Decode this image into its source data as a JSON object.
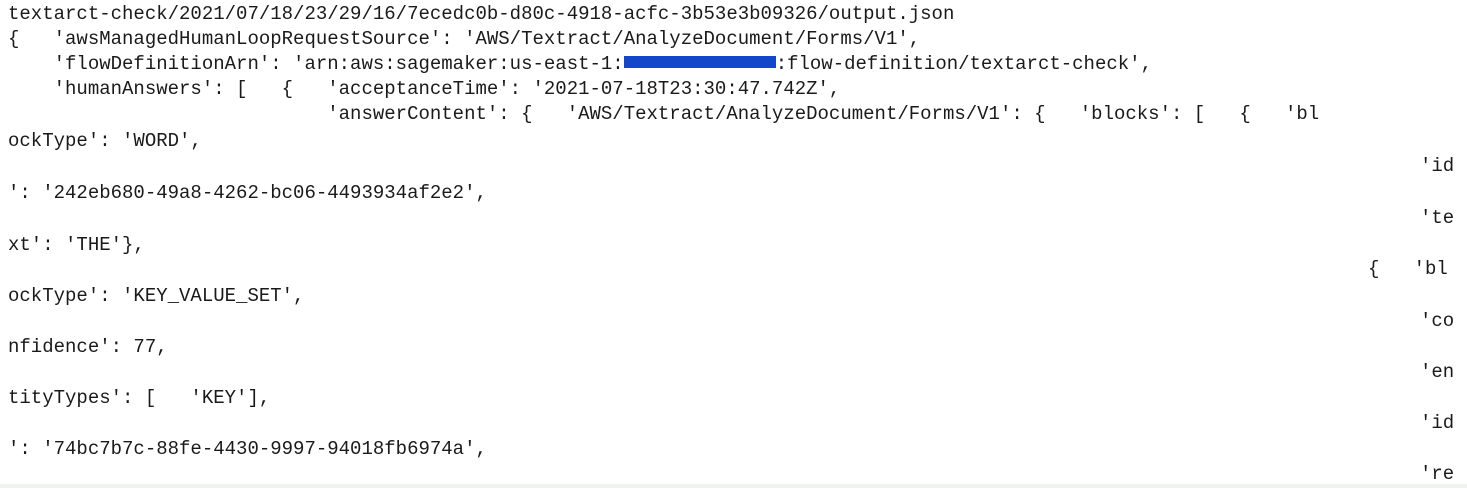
{
  "redaction_color": "#1346c8",
  "terminal": {
    "path_line": "textarct-check/2021/07/18/23/29/16/7ecedc0b-d80c-4918-acfc-3b53e3b09326/output.json",
    "line1": "{   'awsManagedHumanLoopRequestSource': 'AWS/Textract/AnalyzeDocument/Forms/V1',",
    "line2_before": "    'flowDefinitionArn': 'arn:aws:sagemaker:us-east-1:",
    "line2_after": ":flow-definition/textarct-check',",
    "line3": "    'humanAnswers': [   {   'acceptanceTime': '2021-07-18T23:30:47.742Z',",
    "line4": "                            'answerContent': {   'AWS/Textract/AnalyzeDocument/Forms/V1': {   'blocks': [   {   'bl",
    "line5": "ockType': 'WORD',",
    "line6": "'id",
    "line7": "': '242eb680-49a8-4262-bc06-4493934af2e2',",
    "line8": "'te",
    "line9": "xt': 'THE'},",
    "line10": "{   'bl",
    "line11": "ockType': 'KEY_VALUE_SET',",
    "line12": "'co",
    "line13": "nfidence': 77,",
    "line14": "'en",
    "line15": "tityTypes': [   'KEY'],",
    "line16": "'id",
    "line17": "': '74bc7b7c-88fe-4430-9997-94018fb6974a',",
    "line18": "'re"
  }
}
